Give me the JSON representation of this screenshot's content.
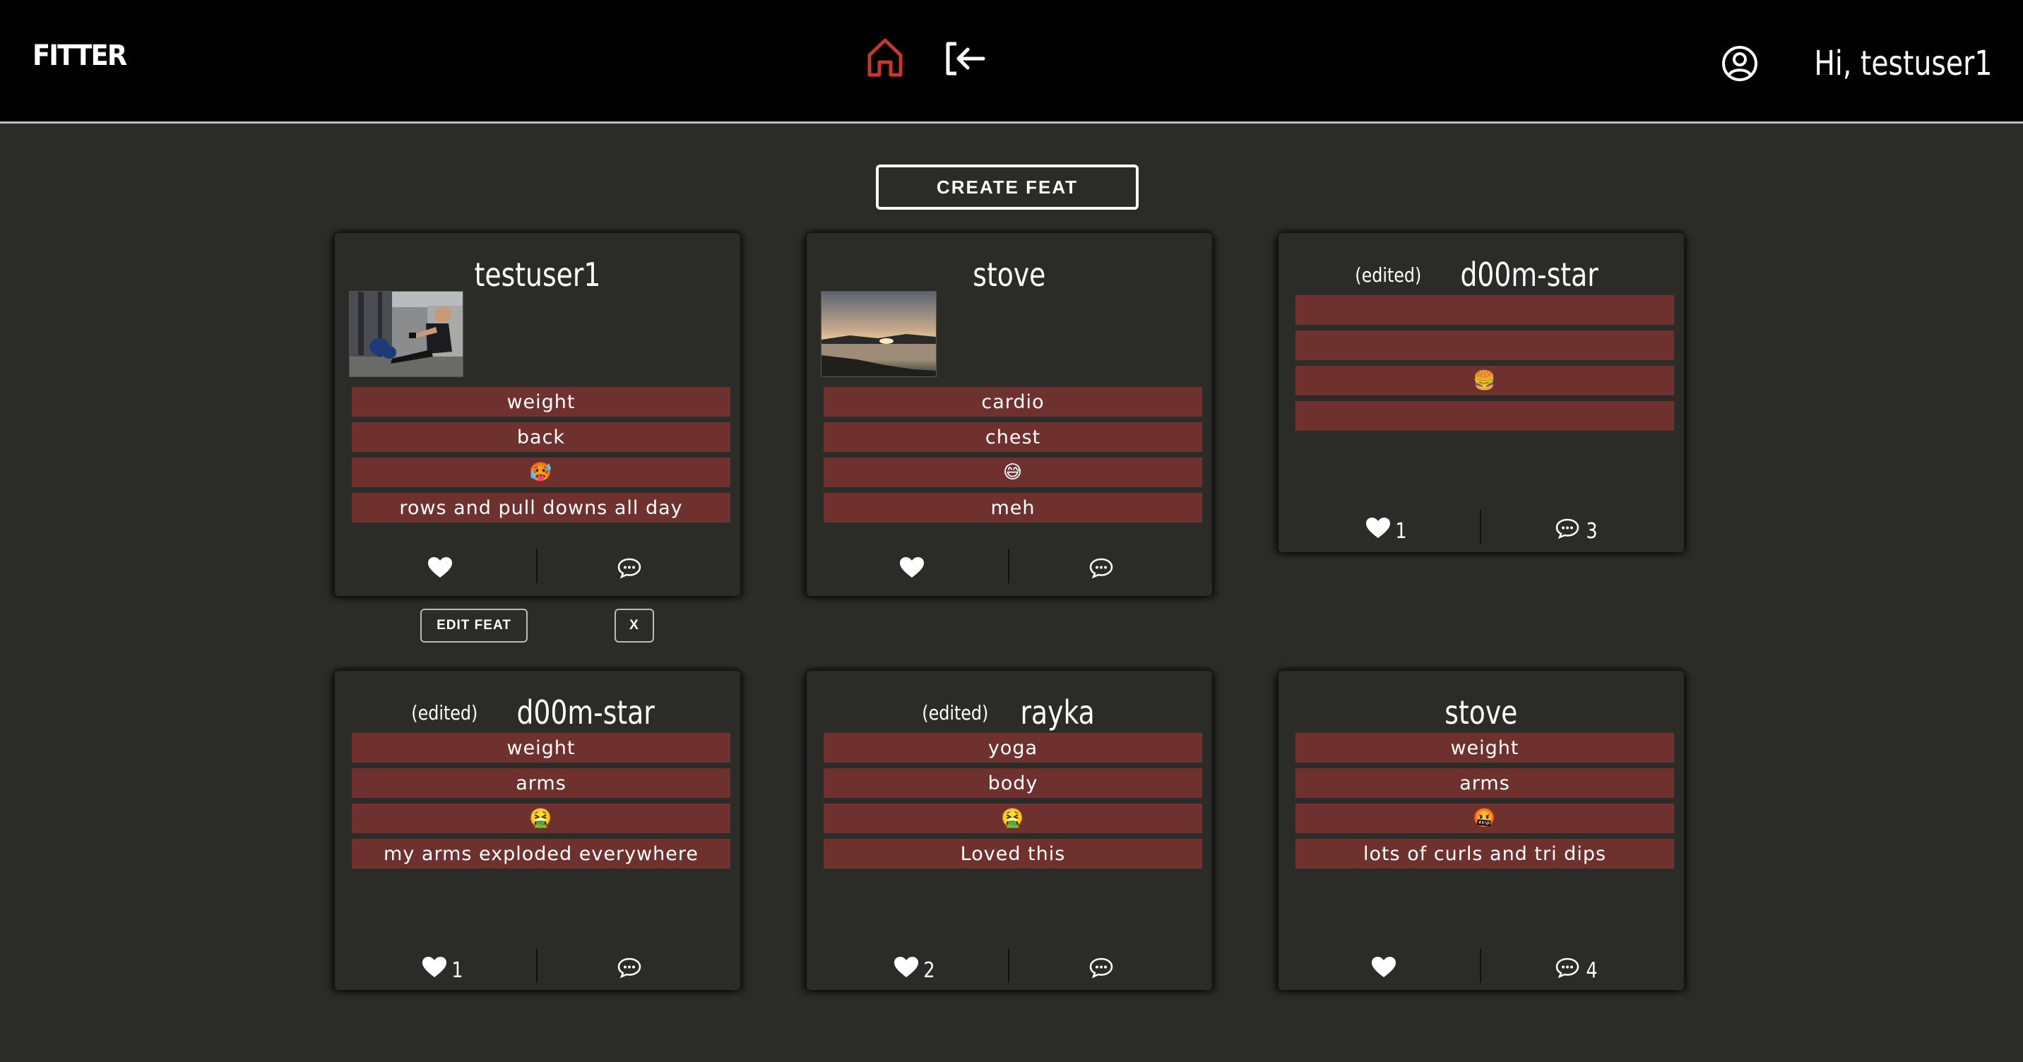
{
  "header": {
    "logo": "FITTER",
    "greeting": "Hi, testuser1"
  },
  "create_button": "CREATE FEAT",
  "feats": [
    {
      "edited": "",
      "author": "testuser1",
      "image": "rowing-machine-photo",
      "tags": [
        "weight",
        "back",
        "🥵",
        "rows and pull downs all day"
      ],
      "likes": "",
      "comments": ""
    },
    {
      "edited": "",
      "author": "stove",
      "image": "sunset-lake-photo",
      "tags": [
        "cardio",
        "chest",
        "😅",
        "meh"
      ],
      "likes": "",
      "comments": ""
    },
    {
      "edited": "(edited)",
      "author": "d00m-star",
      "tags": [
        "",
        "",
        "🍔",
        ""
      ],
      "likes": "1",
      "comments": "3"
    },
    {
      "edited": "(edited)",
      "author": "d00m-star",
      "tags": [
        "weight",
        "arms",
        "🤮",
        "my arms exploded everywhere"
      ],
      "likes": "1",
      "comments": ""
    },
    {
      "edited": "(edited)",
      "author": "rayka",
      "tags": [
        "yoga",
        "body",
        "🤮",
        "Loved this"
      ],
      "likes": "2",
      "comments": ""
    },
    {
      "edited": "",
      "author": "stove",
      "tags": [
        "weight",
        "arms",
        "🤬",
        "lots of curls and tri dips"
      ],
      "likes": "",
      "comments": "4"
    }
  ],
  "own_feat_actions": {
    "edit": "EDIT FEAT",
    "delete": "X"
  },
  "colors": {
    "background": "#2b2b28",
    "topbar": "#000000",
    "tag": "#6e312e",
    "home_icon": "#c0392b"
  },
  "icons": {
    "home": "home-icon",
    "logout": "logout-icon",
    "user": "user-circle-icon",
    "like": "heart-icon",
    "comment": "comment-icon"
  }
}
